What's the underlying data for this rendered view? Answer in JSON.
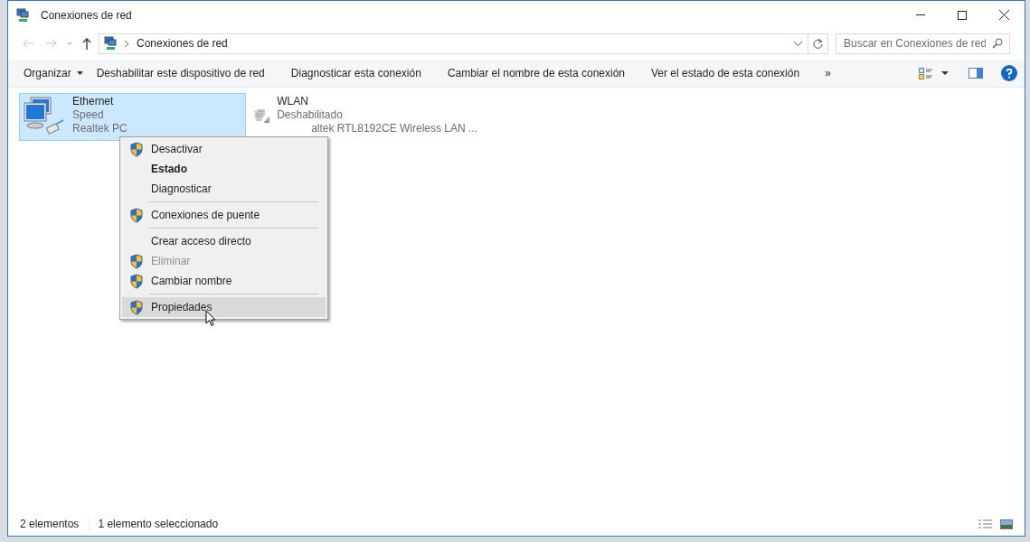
{
  "window": {
    "title": "Conexiones de red"
  },
  "address_bar": {
    "path": "Conexiones de red"
  },
  "search": {
    "placeholder": "Buscar en Conexiones de red"
  },
  "toolbar": {
    "items": [
      {
        "label": "Organizar",
        "kind": "dropdown"
      },
      {
        "label": "Deshabilitar este dispositivo de red",
        "kind": "command"
      },
      {
        "label": "Diagnosticar esta conexión",
        "kind": "command"
      },
      {
        "label": "Cambiar el nombre de esta conexión",
        "kind": "command"
      },
      {
        "label": "Ver el estado de esta conexión",
        "kind": "command"
      },
      {
        "label": "»",
        "kind": "overflow"
      }
    ]
  },
  "connections": [
    {
      "name": "Ethernet",
      "status": "Speed",
      "adapter": "Realtek PC",
      "selected": true,
      "disabled": false,
      "kind": "wired"
    },
    {
      "name": "WLAN",
      "status": "Deshabilitado",
      "adapter": "altek RTL8192CE Wireless LAN ...",
      "selected": false,
      "disabled": true,
      "kind": "wireless"
    }
  ],
  "context_menu": {
    "items": [
      {
        "kind": "item",
        "label": "Desactivar",
        "shield": true,
        "bold": false,
        "disabled": false,
        "selected": false
      },
      {
        "kind": "item",
        "label": "Estado",
        "shield": false,
        "bold": true,
        "disabled": false,
        "selected": false
      },
      {
        "kind": "item",
        "label": "Diagnosticar",
        "shield": false,
        "bold": false,
        "disabled": false,
        "selected": false
      },
      {
        "kind": "separator"
      },
      {
        "kind": "item",
        "label": "Conexiones de puente",
        "shield": true,
        "bold": false,
        "disabled": false,
        "selected": false
      },
      {
        "kind": "separator"
      },
      {
        "kind": "item",
        "label": "Crear acceso directo",
        "shield": false,
        "bold": false,
        "disabled": false,
        "selected": false
      },
      {
        "kind": "item",
        "label": "Eliminar",
        "shield": true,
        "bold": false,
        "disabled": true,
        "selected": false
      },
      {
        "kind": "item",
        "label": "Cambiar nombre",
        "shield": true,
        "bold": false,
        "disabled": false,
        "selected": false
      },
      {
        "kind": "separator"
      },
      {
        "kind": "item",
        "label": "Propiedades",
        "shield": true,
        "bold": false,
        "disabled": false,
        "selected": true
      }
    ]
  },
  "status_bar": {
    "item_count": "2 elementos",
    "selection": "1 elemento seleccionado"
  }
}
